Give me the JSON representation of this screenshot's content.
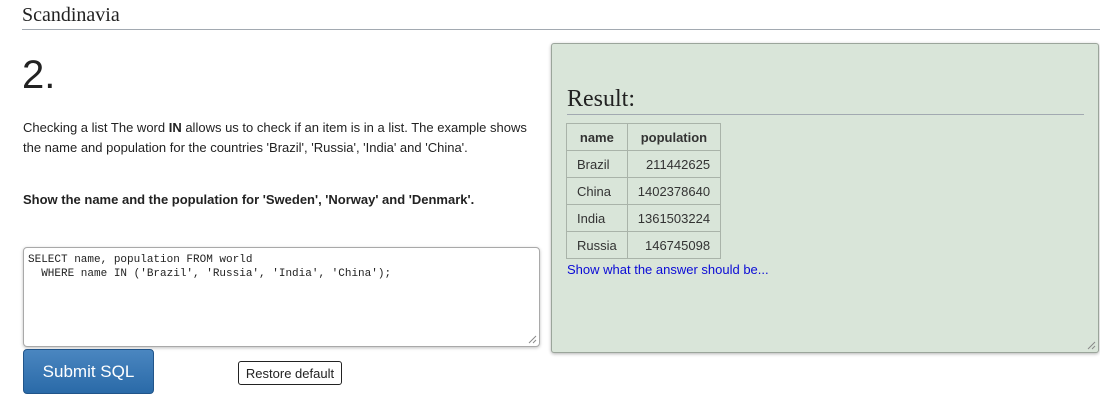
{
  "header": {
    "title": "Scandinavia"
  },
  "question": {
    "number": "2.",
    "desc_prefix": "Checking a list The word ",
    "desc_keyword": "IN",
    "desc_suffix": " allows us to check if an item is in a list. The example shows the name and population for the countries 'Brazil', 'Russia', 'India' and 'China'.",
    "task": "Show the name and the population for 'Sweden', 'Norway' and 'Denmark'."
  },
  "editor": {
    "value": "SELECT name, population FROM world\n  WHERE name IN ('Brazil', 'Russia', 'India', 'China');"
  },
  "buttons": {
    "submit_label": "Submit SQL",
    "restore_label": "Restore default"
  },
  "result": {
    "title": "Result:",
    "columns": [
      "name",
      "population"
    ],
    "rows": [
      [
        "Brazil",
        "211442625"
      ],
      [
        "China",
        "1402378640"
      ],
      [
        "India",
        "1361503224"
      ],
      [
        "Russia",
        "146745098"
      ]
    ],
    "answer_link": "Show what the answer should be..."
  },
  "colors": {
    "result_bg": "#d9e5d9",
    "submit_bg": "#2a6aa8",
    "link": "#0b0bd6"
  }
}
